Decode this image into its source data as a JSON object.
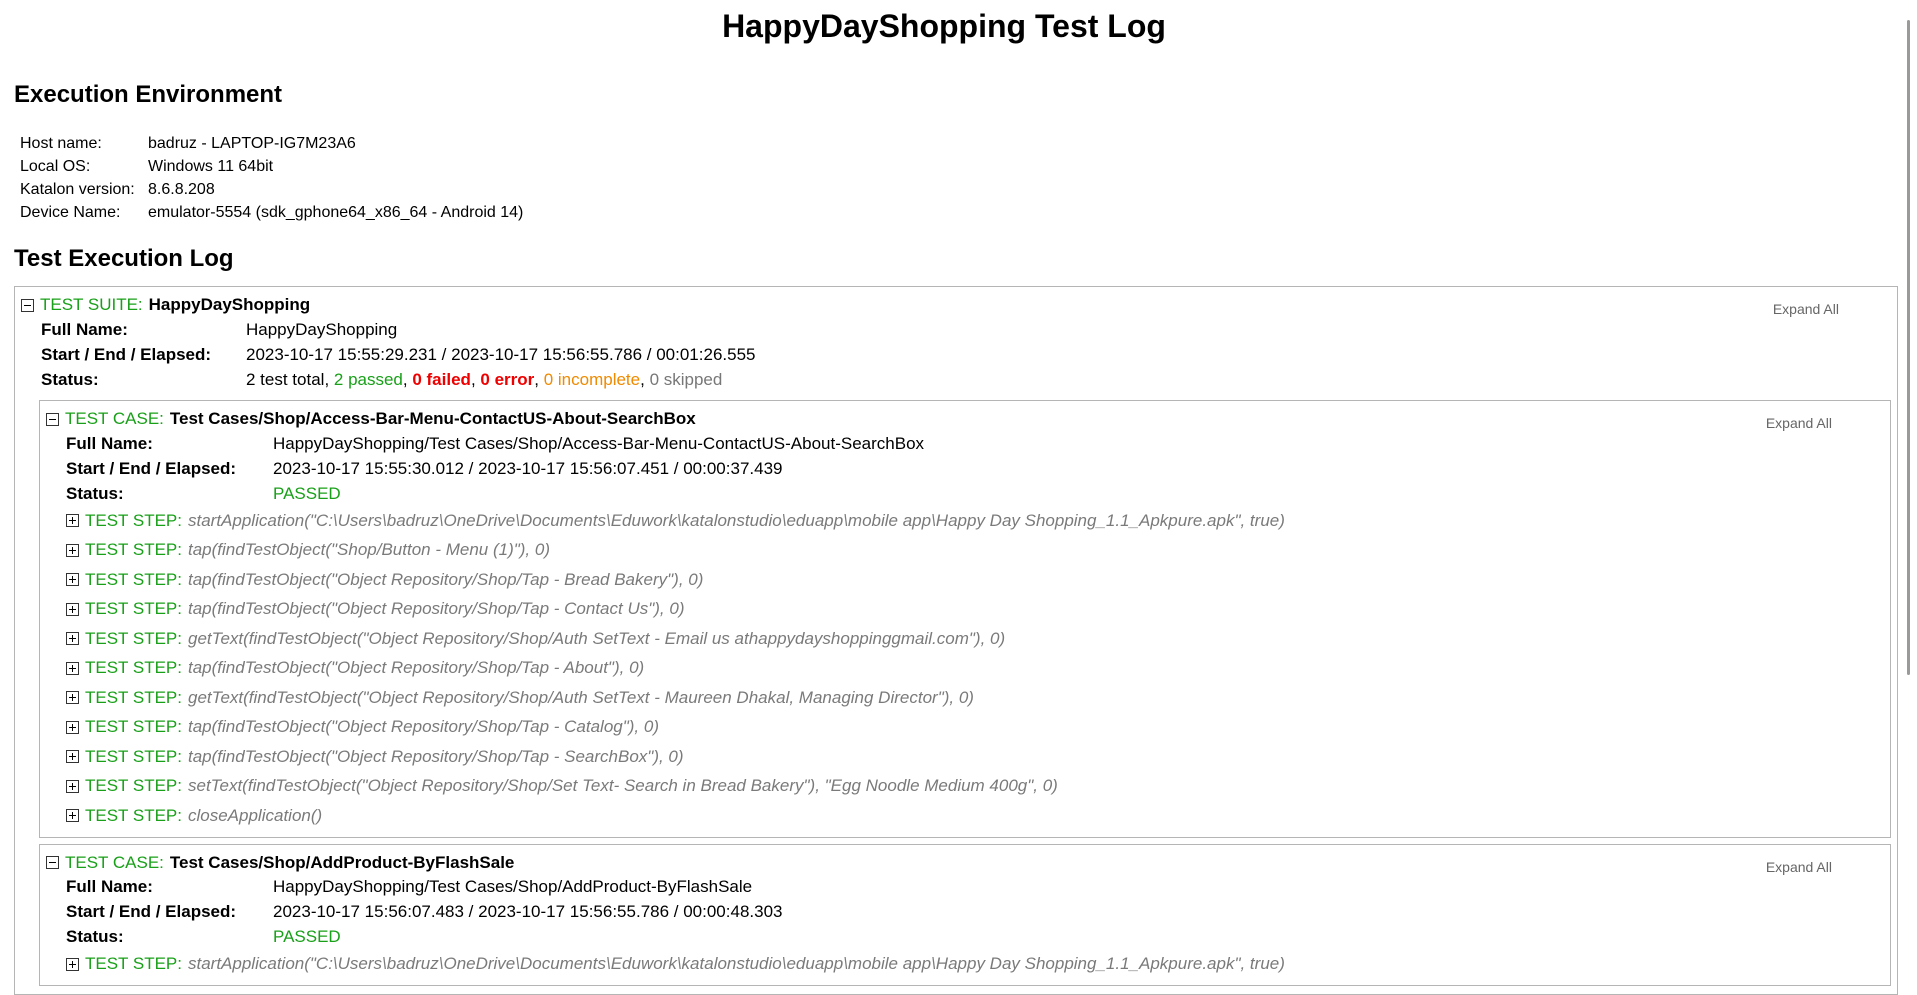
{
  "title": "HappyDayShopping Test Log",
  "environment": {
    "heading": "Execution Environment",
    "rows": [
      {
        "key": "Host name:",
        "value": "badruz - LAPTOP-IG7M23A6"
      },
      {
        "key": "Local OS:",
        "value": "Windows 11 64bit"
      },
      {
        "key": "Katalon version:",
        "value": "8.6.8.208"
      },
      {
        "key": "Device Name:",
        "value": "emulator-5554 (sdk_gphone64_x86_64 - Android 14)"
      }
    ]
  },
  "log": {
    "heading": "Test Execution Log",
    "expand_all": "Expand All",
    "suite": {
      "kind": "TEST SUITE:",
      "name": "HappyDayShopping",
      "labels": {
        "full_name": "Full Name:",
        "start_end": "Start / End / Elapsed:",
        "status": "Status:"
      },
      "full_name": "HappyDayShopping",
      "start_end": "2023-10-17 15:55:29.231 / 2023-10-17 15:56:55.786 / 00:01:26.555",
      "status": {
        "total": "2 test total",
        "passed": "2 passed",
        "failed": "0 failed",
        "error": "0 error",
        "incomplete": "0 incomplete",
        "skipped": "0 skipped"
      }
    },
    "cases": [
      {
        "kind": "TEST CASE:",
        "name": "Test Cases/Shop/Access-Bar-Menu-ContactUS-About-SearchBox",
        "full_name": "HappyDayShopping/Test Cases/Shop/Access-Bar-Menu-ContactUS-About-SearchBox",
        "start_end": "2023-10-17 15:55:30.012 / 2023-10-17 15:56:07.451 / 00:00:37.439",
        "status": "PASSED",
        "steps": [
          {
            "kind": "TEST STEP:",
            "desc": "startApplication(\"C:\\Users\\badruz\\OneDrive\\Documents\\Eduwork\\katalonstudio\\eduapp\\mobile app\\Happy Day Shopping_1.1_Apkpure.apk\", true)"
          },
          {
            "kind": "TEST STEP:",
            "desc": "tap(findTestObject(\"Shop/Button - Menu (1)\"), 0)"
          },
          {
            "kind": "TEST STEP:",
            "desc": "tap(findTestObject(\"Object Repository/Shop/Tap - Bread Bakery\"), 0)"
          },
          {
            "kind": "TEST STEP:",
            "desc": "tap(findTestObject(\"Object Repository/Shop/Tap - Contact Us\"), 0)"
          },
          {
            "kind": "TEST STEP:",
            "desc": "getText(findTestObject(\"Object Repository/Shop/Auth SetText - Email us athappydayshoppinggmail.com\"), 0)"
          },
          {
            "kind": "TEST STEP:",
            "desc": "tap(findTestObject(\"Object Repository/Shop/Tap - About\"), 0)"
          },
          {
            "kind": "TEST STEP:",
            "desc": "getText(findTestObject(\"Object Repository/Shop/Auth SetText - Maureen Dhakal, Managing Director\"), 0)"
          },
          {
            "kind": "TEST STEP:",
            "desc": "tap(findTestObject(\"Object Repository/Shop/Tap - Catalog\"), 0)"
          },
          {
            "kind": "TEST STEP:",
            "desc": "tap(findTestObject(\"Object Repository/Shop/Tap - SearchBox\"), 0)"
          },
          {
            "kind": "TEST STEP:",
            "desc": "setText(findTestObject(\"Object Repository/Shop/Set Text- Search in Bread Bakery\"), \"Egg Noodle Medium 400g\", 0)"
          },
          {
            "kind": "TEST STEP:",
            "desc": "closeApplication()"
          }
        ]
      },
      {
        "kind": "TEST CASE:",
        "name": "Test Cases/Shop/AddProduct-ByFlashSale",
        "full_name": "HappyDayShopping/Test Cases/Shop/AddProduct-ByFlashSale",
        "start_end": "2023-10-17 15:56:07.483 / 2023-10-17 15:56:55.786 / 00:00:48.303",
        "status": "PASSED",
        "steps": [
          {
            "kind": "TEST STEP:",
            "desc": "startApplication(\"C:\\Users\\badruz\\OneDrive\\Documents\\Eduwork\\katalonstudio\\eduapp\\mobile app\\Happy Day Shopping_1.1_Apkpure.apk\", true)"
          }
        ]
      }
    ]
  }
}
